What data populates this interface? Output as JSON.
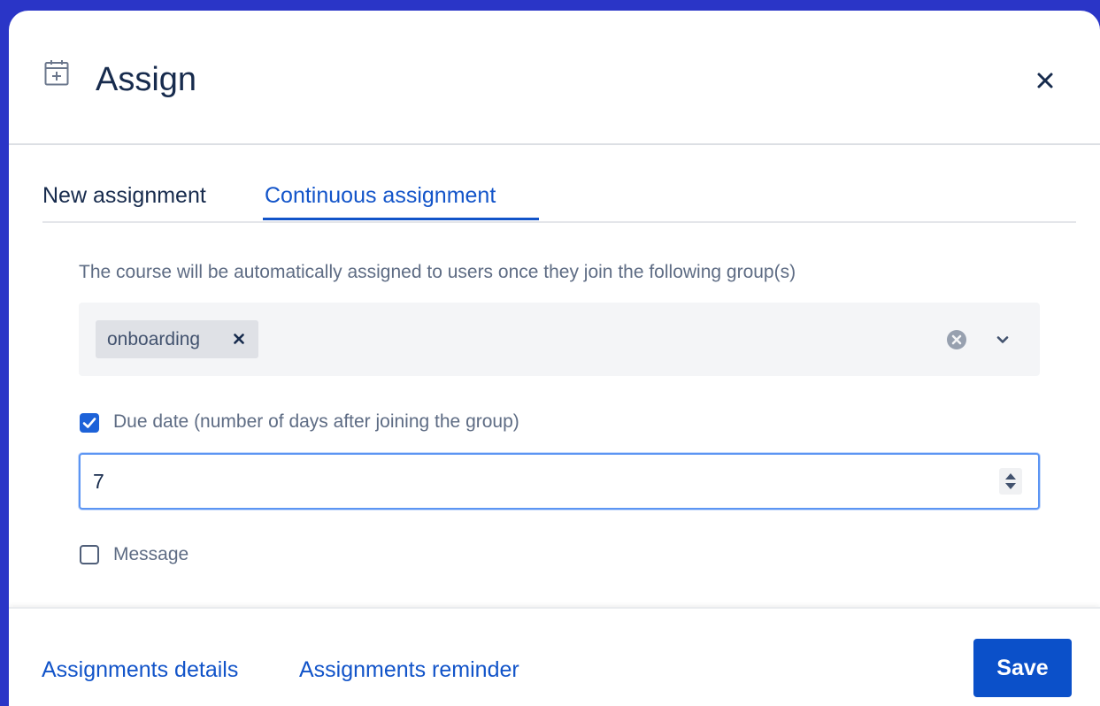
{
  "dialog": {
    "title": "Assign",
    "icon": "calendar-plus-icon",
    "close_icon": "close-icon"
  },
  "tabs": [
    {
      "label": "New assignment",
      "selected": false
    },
    {
      "label": "Continuous assignment",
      "selected": true
    }
  ],
  "continuous": {
    "description": "The course will be automatically assigned to users once they join the following group(s)",
    "groups": {
      "selected": [
        {
          "label": "onboarding",
          "remove_icon": "remove-icon"
        }
      ],
      "clear_icon": "clear-circle-icon",
      "dropdown_icon": "chevron-down-icon"
    },
    "due_date": {
      "checked": true,
      "label": "Due date (number of days after joining the group)",
      "value": "7",
      "stepper_icon": "up-down-stepper-icon"
    },
    "message": {
      "checked": false,
      "label": "Message"
    }
  },
  "footer": {
    "links": [
      {
        "label": "Assignments details"
      },
      {
        "label": "Assignments reminder"
      }
    ],
    "save_label": "Save"
  },
  "colors": {
    "backdrop": "#2a35c7",
    "accent": "#1254c9",
    "primary_button": "#0b50c9",
    "checkbox_checked": "#1d62d8",
    "focus_border": "#5c95f3",
    "select_background": "#f4f5f7",
    "chip_background": "#dfe1e6"
  }
}
